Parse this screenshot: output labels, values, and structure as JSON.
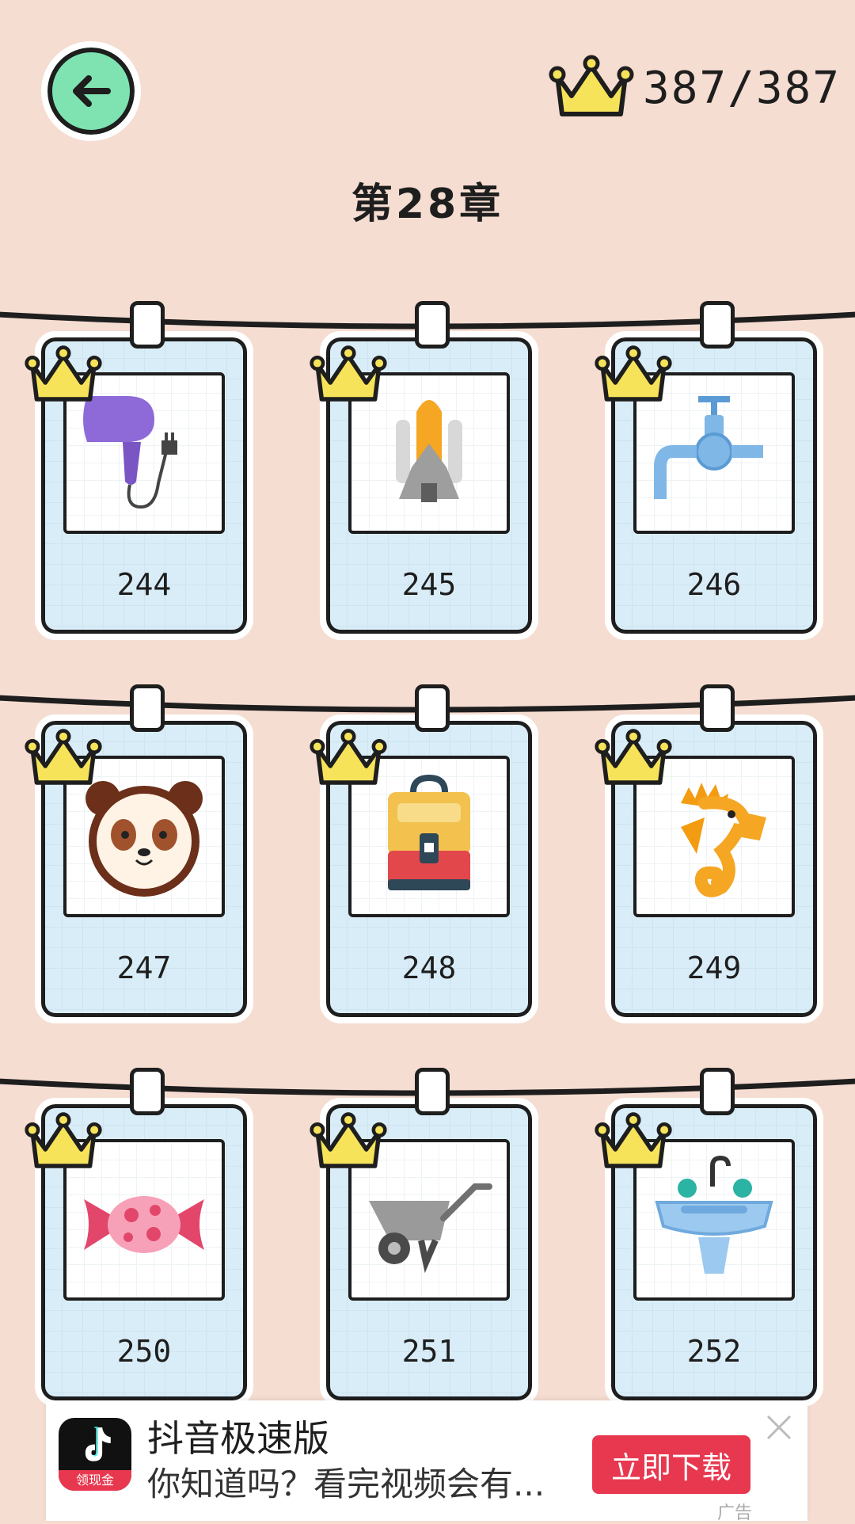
{
  "header": {
    "crowns_text": "387/387",
    "chapter_title": "第28章"
  },
  "colors": {
    "background": "#f6ddd1",
    "back_button": "#7ee3b0",
    "crown": "#f6e35a",
    "ad_button": "#e8384f"
  },
  "levels": [
    {
      "number": "244",
      "icon": "hair-dryer-icon",
      "completed": true
    },
    {
      "number": "245",
      "icon": "space-shuttle-icon",
      "completed": true
    },
    {
      "number": "246",
      "icon": "water-faucet-icon",
      "completed": true
    },
    {
      "number": "247",
      "icon": "panda-icon",
      "completed": true
    },
    {
      "number": "248",
      "icon": "backpack-icon",
      "completed": true
    },
    {
      "number": "249",
      "icon": "seahorse-icon",
      "completed": true
    },
    {
      "number": "250",
      "icon": "candy-icon",
      "completed": true
    },
    {
      "number": "251",
      "icon": "wheelbarrow-icon",
      "completed": true
    },
    {
      "number": "252",
      "icon": "sink-icon",
      "completed": true
    }
  ],
  "ad": {
    "app_name": "抖音极速版",
    "icon_label": "领现金",
    "description": "你知道吗？看完视频会有...",
    "button_label": "立即下载",
    "tag": "广告"
  }
}
